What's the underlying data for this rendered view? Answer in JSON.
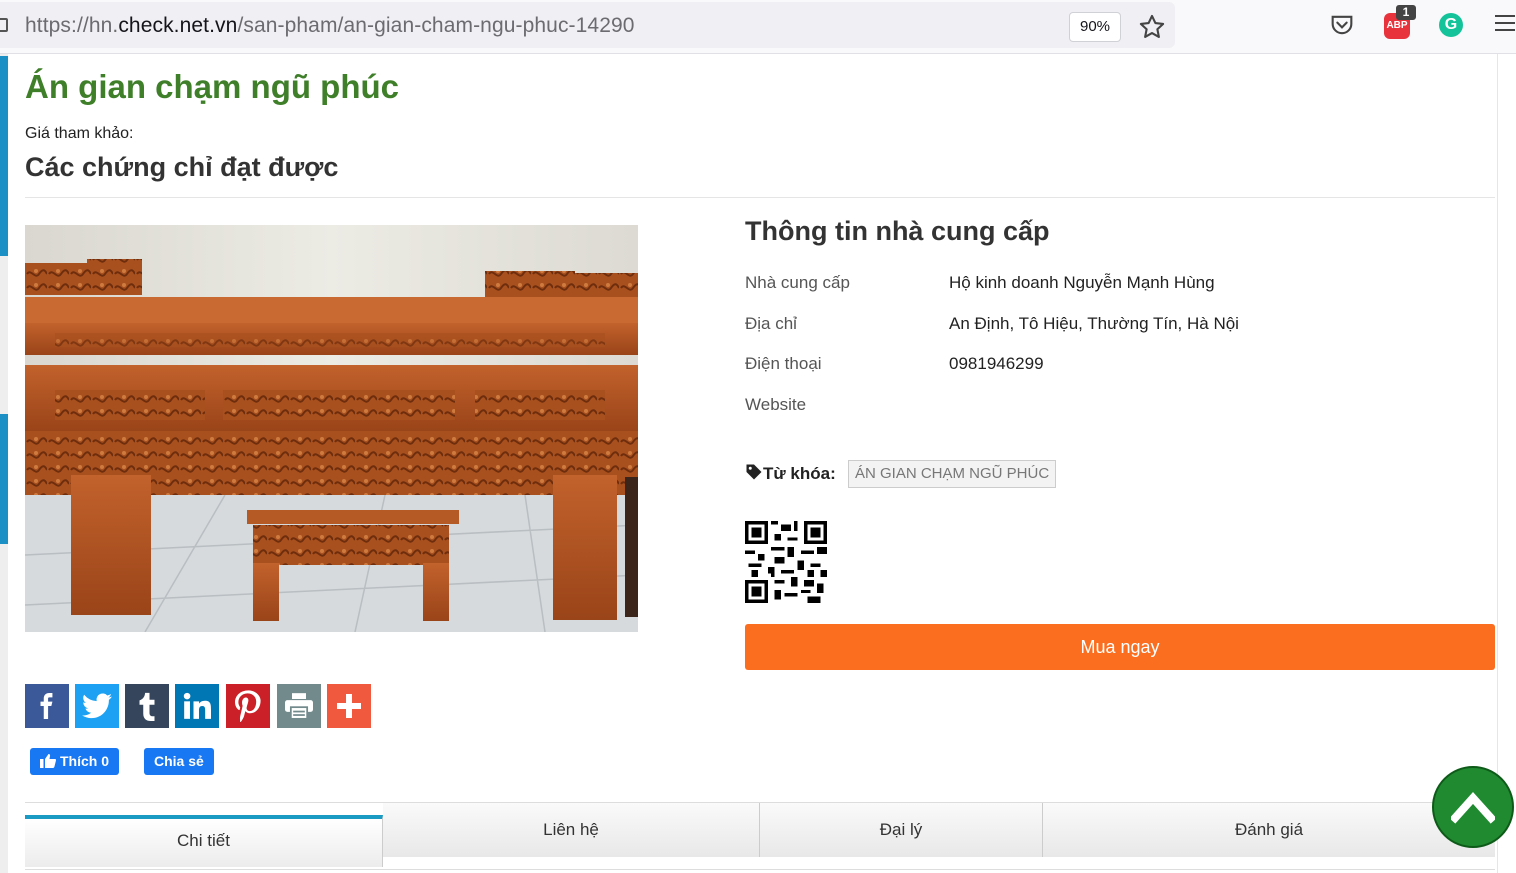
{
  "browser": {
    "url_prefix": "https://hn.",
    "url_host": "check.net.vn",
    "url_path": "/san-pham/an-gian-cham-ngu-phuc-14290",
    "zoom": "90%",
    "abp_label": "ABP",
    "abp_badge": "1",
    "grammarly_label": "G"
  },
  "product": {
    "title": "Án gian chạm ngũ phúc",
    "ref_price_label": "Giá tham khảo:",
    "certs_heading": "Các chứng chỉ đạt được"
  },
  "supplier": {
    "heading": "Thông tin nhà cung cấp",
    "rows": [
      {
        "label": "Nhà cung cấp",
        "value": "Hộ kinh doanh Nguyễn Mạnh Hùng"
      },
      {
        "label": "Địa chỉ",
        "value": "An Định, Tô Hiệu, Thường Tín, Hà Nội"
      },
      {
        "label": "Điện thoại",
        "value": "0981946299"
      },
      {
        "label": "Website",
        "value": ""
      }
    ]
  },
  "tags": {
    "label": "Từ khóa:",
    "items": [
      "ÁN GIAN CHẠM NGŨ PHÚC"
    ]
  },
  "buy_button": "Mua ngay",
  "share_icons": [
    "facebook-icon",
    "twitter-icon",
    "tumblr-icon",
    "linkedin-icon",
    "pinterest-icon",
    "print-icon",
    "add-more-icon"
  ],
  "share_colors": [
    "#3b5998",
    "#1da1f2",
    "#35465c",
    "#0077b5",
    "#cb2027",
    "#738a8d",
    "#f0593d"
  ],
  "facebook": {
    "like_label": "Thích 0",
    "share_label": "Chia sẻ"
  },
  "tabs": [
    {
      "label": "Chi tiết",
      "active": true
    },
    {
      "label": "Liên hệ",
      "active": false
    },
    {
      "label": "Đại lý",
      "active": false
    },
    {
      "label": "Đánh giá",
      "active": false
    }
  ]
}
